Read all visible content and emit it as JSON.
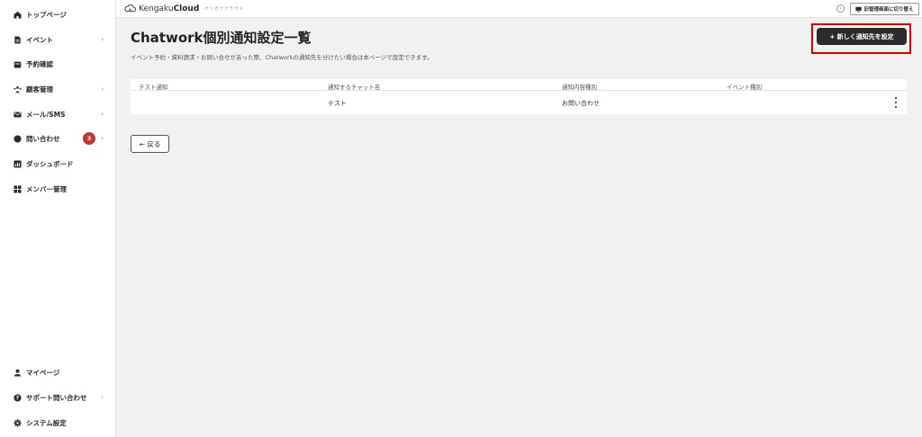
{
  "sidebar": {
    "items": [
      {
        "label": "トップページ",
        "icon": "home-icon",
        "chevron": ""
      },
      {
        "label": "イベント",
        "icon": "document-icon",
        "chevron": "›"
      },
      {
        "label": "予約確認",
        "icon": "calendar-icon",
        "chevron": ""
      },
      {
        "label": "顧客管理",
        "icon": "people-icon",
        "chevron": "›"
      },
      {
        "label": "メール/SMS",
        "icon": "mail-icon",
        "chevron": "›"
      },
      {
        "label": "問い合わせ",
        "icon": "chat-icon",
        "chevron": "›",
        "badge": "3"
      },
      {
        "label": "ダッシュボード",
        "icon": "chart-icon",
        "chevron": ""
      },
      {
        "label": "メンバー管理",
        "icon": "grid-icon",
        "chevron": ""
      }
    ],
    "bottom_items": [
      {
        "label": "マイページ",
        "icon": "user-icon",
        "chevron": ""
      },
      {
        "label": "サポート問い合わせ",
        "icon": "help-icon",
        "chevron": "›"
      },
      {
        "label": "システム設定",
        "icon": "gear-icon",
        "chevron": ""
      }
    ]
  },
  "topbar": {
    "brand_light": "Kengaku",
    "brand_bold": "Cloud",
    "brand_sub": "ケンガククラウド",
    "switch_label": "旧管理画面に切り替え"
  },
  "main": {
    "title": "Chatwork個別通知設定一覧",
    "description": "イベント予約・資料請求・お問い合せがあった際、Chatworkの通知先を分けたい場合は本ページで設定できます。",
    "new_button": "+ 新しく通知先を設定",
    "back_button": "← 戻る",
    "table": {
      "headers": [
        "テスト通知",
        "通知するチャット名",
        "通知内容種別",
        "イベント種別"
      ],
      "rows": [
        [
          "",
          "テスト",
          "お問い合わせ",
          ""
        ]
      ]
    }
  },
  "colors": {
    "accent_dark": "#2b2b2b",
    "badge": "#c0392b",
    "highlight": "#e00000",
    "background": "#f2f1ef"
  }
}
